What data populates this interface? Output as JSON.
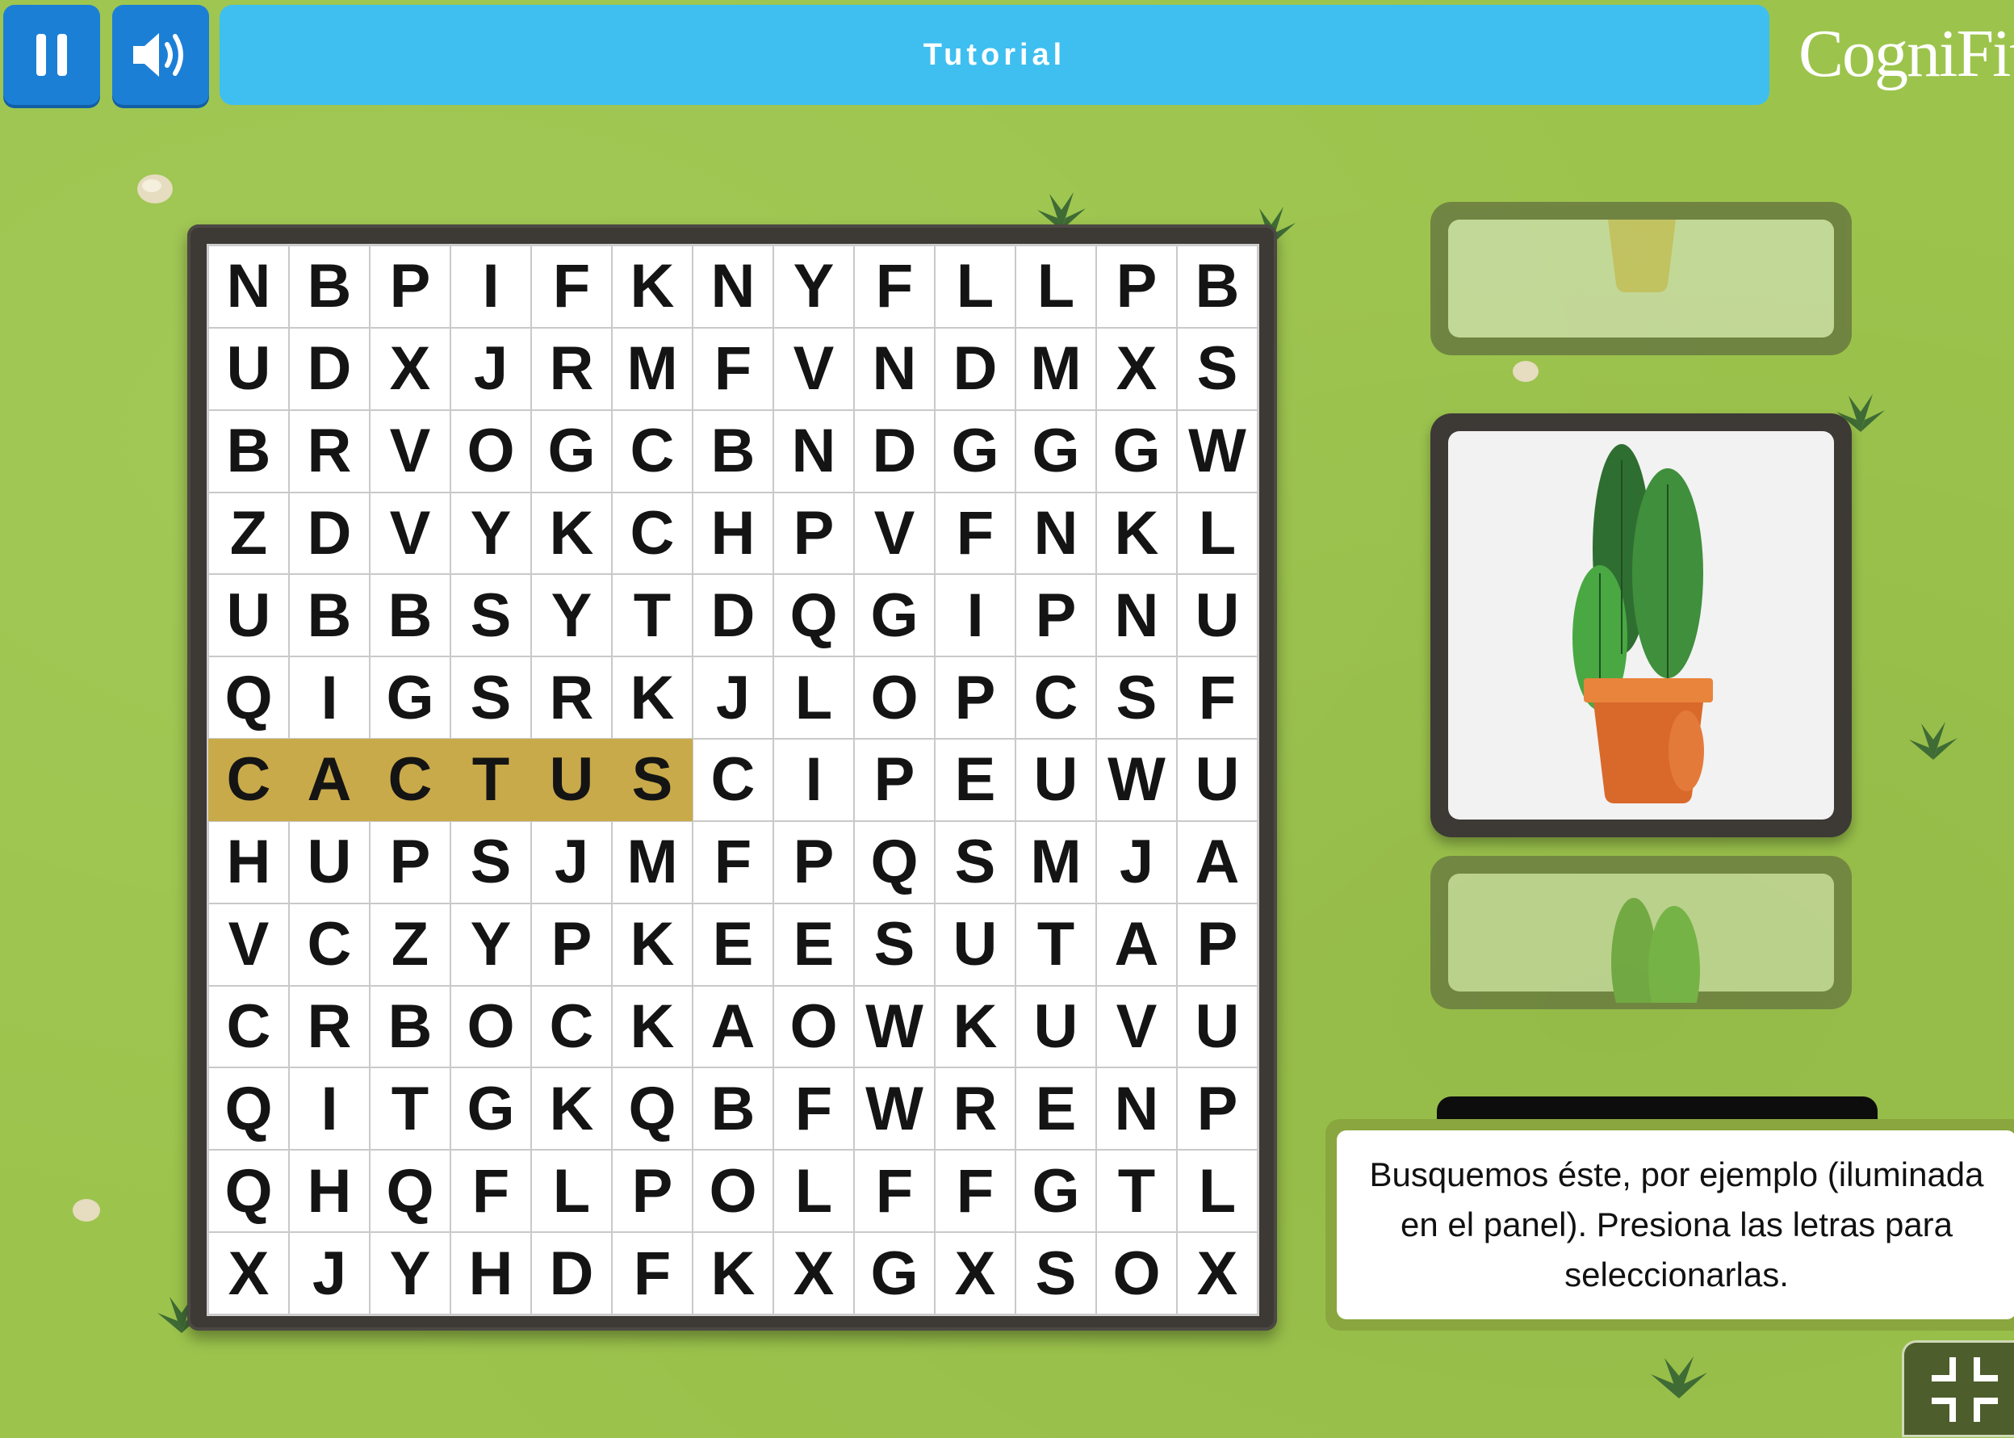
{
  "header": {
    "title": "Tutorial",
    "logo": "CogniFit",
    "pause_icon": "pause-icon",
    "sound_icon": "speaker-icon"
  },
  "grid": {
    "rows": [
      [
        "N",
        "B",
        "P",
        "I",
        "F",
        "K",
        "N",
        "Y",
        "F",
        "L",
        "L",
        "P",
        "B"
      ],
      [
        "U",
        "D",
        "X",
        "J",
        "R",
        "M",
        "F",
        "V",
        "N",
        "D",
        "M",
        "X",
        "S"
      ],
      [
        "B",
        "R",
        "V",
        "O",
        "G",
        "C",
        "B",
        "N",
        "D",
        "G",
        "G",
        "G",
        "W"
      ],
      [
        "Z",
        "D",
        "V",
        "Y",
        "K",
        "C",
        "H",
        "P",
        "V",
        "F",
        "N",
        "K",
        "L"
      ],
      [
        "U",
        "B",
        "B",
        "S",
        "Y",
        "T",
        "D",
        "Q",
        "G",
        "I",
        "P",
        "N",
        "U"
      ],
      [
        "Q",
        "I",
        "G",
        "S",
        "R",
        "K",
        "J",
        "L",
        "O",
        "P",
        "C",
        "S",
        "F"
      ],
      [
        "C",
        "A",
        "C",
        "T",
        "U",
        "S",
        "C",
        "I",
        "P",
        "E",
        "U",
        "W",
        "U"
      ],
      [
        "H",
        "U",
        "P",
        "S",
        "J",
        "M",
        "F",
        "P",
        "Q",
        "S",
        "M",
        "J",
        "A"
      ],
      [
        "V",
        "C",
        "Z",
        "Y",
        "P",
        "K",
        "E",
        "E",
        "S",
        "U",
        "T",
        "A",
        "P"
      ],
      [
        "C",
        "R",
        "B",
        "O",
        "C",
        "K",
        "A",
        "O",
        "W",
        "K",
        "U",
        "V",
        "U"
      ],
      [
        "Q",
        "I",
        "T",
        "G",
        "K",
        "Q",
        "B",
        "F",
        "W",
        "R",
        "E",
        "N",
        "P"
      ],
      [
        "Q",
        "H",
        "Q",
        "F",
        "L",
        "P",
        "O",
        "L",
        "F",
        "F",
        "G",
        "T",
        "L"
      ],
      [
        "X",
        "J",
        "Y",
        "H",
        "D",
        "F",
        "K",
        "X",
        "G",
        "X",
        "S",
        "O",
        "X"
      ]
    ],
    "highlighted_word": "CACTUS",
    "highlight_color": "#c9aa4a"
  },
  "tooltip": {
    "text": "Busquemos éste, por ejemplo (iluminada en el panel). Presiona las letras para seleccionarlas."
  },
  "colors": {
    "background": "#9cc44c",
    "title_bar": "#3ebff0",
    "buttons": "#1c7fd6"
  }
}
